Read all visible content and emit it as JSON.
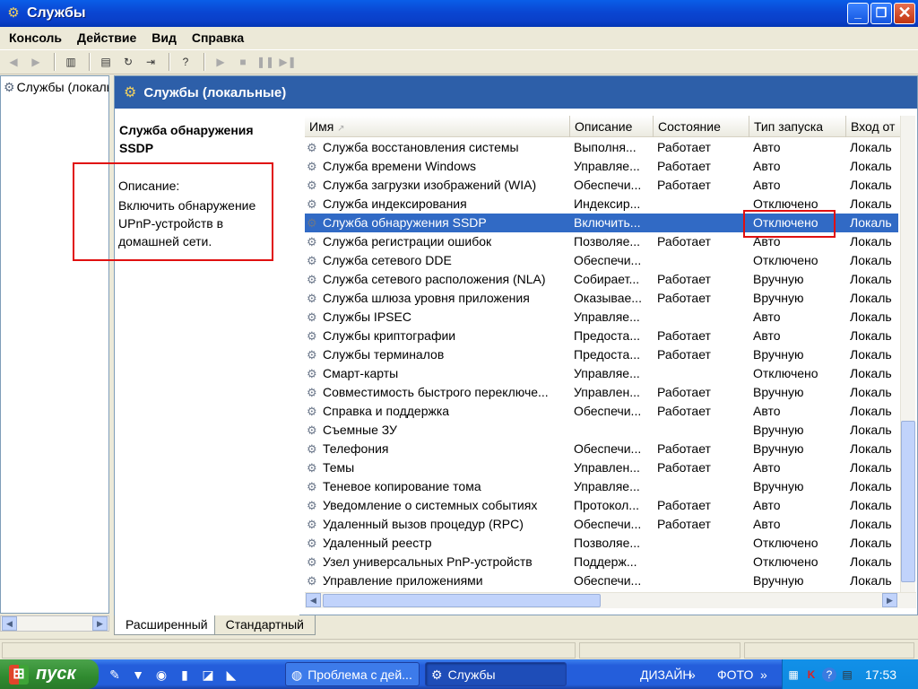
{
  "window": {
    "title": "Службы",
    "min_glyph": "_",
    "max_glyph": "❐",
    "close_glyph": "✕"
  },
  "menu": [
    "Консоль",
    "Действие",
    "Вид",
    "Справка"
  ],
  "tree": {
    "item_label": "Службы (локальные)"
  },
  "header": {
    "title": "Службы (локальные)"
  },
  "description": {
    "service_name": "Служба обнаружения SSDP",
    "label": "Описание:",
    "text": "Включить обнаружение UPnP-устройств в домашней сети."
  },
  "columns": [
    "Имя",
    "Описание",
    "Состояние",
    "Тип запуска",
    "Вход от"
  ],
  "rows": [
    {
      "name": "Служба восстановления системы",
      "desc": "Выполня...",
      "state": "Работает",
      "startup": "Авто",
      "logon": "Локаль"
    },
    {
      "name": "Служба времени Windows",
      "desc": "Управляе...",
      "state": "Работает",
      "startup": "Авто",
      "logon": "Локаль"
    },
    {
      "name": "Служба загрузки изображений (WIA)",
      "desc": "Обеспечи...",
      "state": "Работает",
      "startup": "Авто",
      "logon": "Локаль"
    },
    {
      "name": "Служба индексирования",
      "desc": "Индексир...",
      "state": "",
      "startup": "Отключено",
      "logon": "Локаль"
    },
    {
      "name": "Служба обнаружения SSDP",
      "desc": "Включить...",
      "state": "",
      "startup": "Отключено",
      "logon": "Локаль",
      "selected": true
    },
    {
      "name": "Служба регистрации ошибок",
      "desc": "Позволяе...",
      "state": "Работает",
      "startup": "Авто",
      "logon": "Локаль"
    },
    {
      "name": "Служба сетевого DDE",
      "desc": "Обеспечи...",
      "state": "",
      "startup": "Отключено",
      "logon": "Локаль"
    },
    {
      "name": "Служба сетевого расположения (NLA)",
      "desc": "Собирает...",
      "state": "Работает",
      "startup": "Вручную",
      "logon": "Локаль"
    },
    {
      "name": "Служба шлюза уровня приложения",
      "desc": "Оказывае...",
      "state": "Работает",
      "startup": "Вручную",
      "logon": "Локаль"
    },
    {
      "name": "Службы IPSEC",
      "desc": "Управляе...",
      "state": "",
      "startup": "Авто",
      "logon": "Локаль"
    },
    {
      "name": "Службы криптографии",
      "desc": "Предоста...",
      "state": "Работает",
      "startup": "Авто",
      "logon": "Локаль"
    },
    {
      "name": "Службы терминалов",
      "desc": "Предоста...",
      "state": "Работает",
      "startup": "Вручную",
      "logon": "Локаль"
    },
    {
      "name": "Смарт-карты",
      "desc": "Управляе...",
      "state": "",
      "startup": "Отключено",
      "logon": "Локаль"
    },
    {
      "name": "Совместимость быстрого переключе...",
      "desc": "Управлен...",
      "state": "Работает",
      "startup": "Вручную",
      "logon": "Локаль"
    },
    {
      "name": "Справка и поддержка",
      "desc": "Обеспечи...",
      "state": "Работает",
      "startup": "Авто",
      "logon": "Локаль"
    },
    {
      "name": "Съемные ЗУ",
      "desc": "",
      "state": "",
      "startup": "Вручную",
      "logon": "Локаль"
    },
    {
      "name": "Телефония",
      "desc": "Обеспечи...",
      "state": "Работает",
      "startup": "Вручную",
      "logon": "Локаль"
    },
    {
      "name": "Темы",
      "desc": "Управлен...",
      "state": "Работает",
      "startup": "Авто",
      "logon": "Локаль"
    },
    {
      "name": "Теневое копирование тома",
      "desc": "Управляе...",
      "state": "",
      "startup": "Вручную",
      "logon": "Локаль"
    },
    {
      "name": "Уведомление о системных событиях",
      "desc": "Протокол...",
      "state": "Работает",
      "startup": "Авто",
      "logon": "Локаль"
    },
    {
      "name": "Удаленный вызов процедур (RPC)",
      "desc": "Обеспечи...",
      "state": "Работает",
      "startup": "Авто",
      "logon": "Локаль"
    },
    {
      "name": "Удаленный реестр",
      "desc": "Позволяе...",
      "state": "",
      "startup": "Отключено",
      "logon": "Локаль"
    },
    {
      "name": "Узел универсальных PnP-устройств",
      "desc": "Поддерж...",
      "state": "",
      "startup": "Отключено",
      "logon": "Локаль"
    },
    {
      "name": "Управление приложениями",
      "desc": "Обеспечи...",
      "state": "",
      "startup": "Вручную",
      "logon": "Локаль"
    }
  ],
  "tabs": [
    "Расширенный",
    "Стандартный"
  ],
  "taskbar": {
    "start_label": "пуск",
    "tasks": [
      "Проблема с дей...",
      "Службы"
    ],
    "toolbar_labels": [
      "ДИЗАЙН",
      "ФОТО"
    ],
    "clock": "17:53"
  },
  "colors": {
    "selection": "#316ac5",
    "highlight_box": "#e01010",
    "header_band": "#2d5fa9"
  }
}
